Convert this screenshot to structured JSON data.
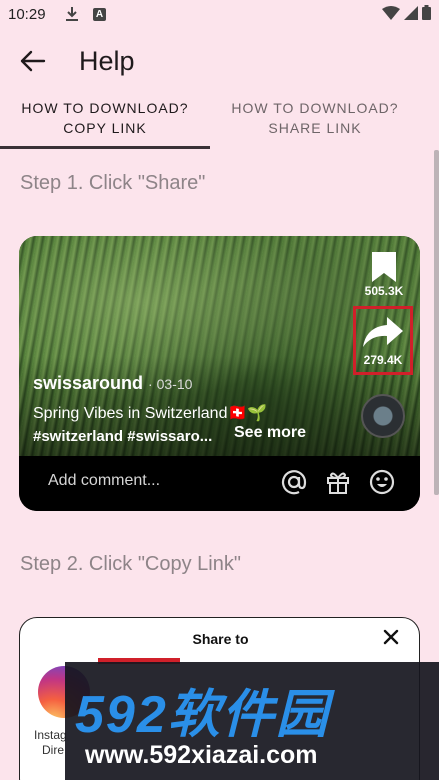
{
  "status_bar": {
    "time": "10:29"
  },
  "app_bar": {
    "title": "Help"
  },
  "tabs": [
    {
      "line1": "HOW TO DOWNLOAD?",
      "line2": "COPY LINK",
      "selected": true
    },
    {
      "line1": "HOW TO DOWNLOAD?",
      "line2": "SHARE LINK",
      "selected": false
    }
  ],
  "step1": {
    "label": "Step 1. Click \"Share\"",
    "video": {
      "bookmark_count": "505.3K",
      "share_count": "279.4K",
      "username": "swissaround",
      "date": "· 03-10",
      "caption": "Spring Vibes in Switzerland🇨🇭🌱",
      "hashtags": "#switzerland #swissaro...",
      "see_more": "See more",
      "comment_placeholder": "Add comment..."
    }
  },
  "step2": {
    "label": "Step 2. Click \"Copy Link\"",
    "share_sheet": {
      "title": "Share to",
      "first_app_line1": "Instag",
      "first_app_line2": "Dire"
    }
  },
  "watermark": {
    "brand": "592软件园",
    "url": "www.592xiazai.com"
  },
  "colors": {
    "background": "#fce4ec",
    "highlight": "#d0202a",
    "watermark_blue": "#2a8fe8"
  }
}
